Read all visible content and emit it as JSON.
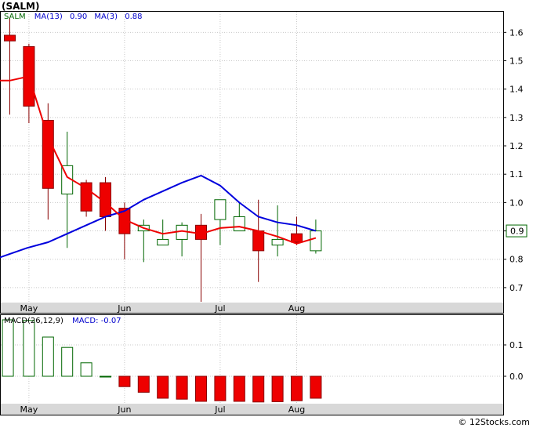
{
  "chart_data": [
    {
      "type": "candlestick",
      "ticker": "(SALM)",
      "legend": {
        "symbol": "SALM",
        "ma13_label": "MA(13)",
        "ma13_value": "0.90",
        "ma3_label": "MA(3)",
        "ma3_value": "0.88"
      },
      "ylim": [
        0.65,
        1.67
      ],
      "y_ticks": [
        "0.7",
        "0.8",
        "0.9",
        "1.0",
        "1.1",
        "1.2",
        "1.3",
        "1.4",
        "1.5",
        "1.6"
      ],
      "x_labels": [
        "May",
        "Jun",
        "Jul",
        "Aug"
      ],
      "x_label_weeks": [
        1,
        6,
        11,
        15
      ],
      "last_price": "0.9",
      "candles": [
        {
          "week": 0,
          "open": 1.59,
          "high": 1.65,
          "low": 1.31,
          "close": 1.57
        },
        {
          "week": 1,
          "open": 1.55,
          "high": 1.56,
          "low": 1.28,
          "close": 1.34
        },
        {
          "week": 2,
          "open": 1.29,
          "high": 1.35,
          "low": 0.94,
          "close": 1.05
        },
        {
          "week": 3,
          "open": 1.03,
          "high": 1.25,
          "low": 0.84,
          "close": 1.13
        },
        {
          "week": 4,
          "open": 1.07,
          "high": 1.08,
          "low": 0.95,
          "close": 0.97
        },
        {
          "week": 5,
          "open": 1.07,
          "high": 1.09,
          "low": 0.9,
          "close": 0.95
        },
        {
          "week": 6,
          "open": 0.98,
          "high": 1.0,
          "low": 0.8,
          "close": 0.89
        },
        {
          "week": 7,
          "open": 0.9,
          "high": 0.94,
          "low": 0.79,
          "close": 0.92
        },
        {
          "week": 8,
          "open": 0.85,
          "high": 0.94,
          "low": 0.85,
          "close": 0.87
        },
        {
          "week": 9,
          "open": 0.87,
          "high": 0.93,
          "low": 0.81,
          "close": 0.92
        },
        {
          "week": 10,
          "open": 0.92,
          "high": 0.96,
          "low": 0.65,
          "close": 0.87
        },
        {
          "week": 11,
          "open": 0.94,
          "high": 1.01,
          "low": 0.85,
          "close": 1.01
        },
        {
          "week": 12,
          "open": 0.9,
          "high": 1.0,
          "low": 0.9,
          "close": 0.95
        },
        {
          "week": 13,
          "open": 0.9,
          "high": 1.01,
          "low": 0.72,
          "close": 0.83
        },
        {
          "week": 14,
          "open": 0.85,
          "high": 0.99,
          "low": 0.81,
          "close": 0.87
        },
        {
          "week": 15,
          "open": 0.89,
          "high": 0.95,
          "low": 0.85,
          "close": 0.86
        },
        {
          "week": 16,
          "open": 0.83,
          "high": 0.94,
          "low": 0.82,
          "close": 0.9
        }
      ],
      "series": [
        {
          "name": "MA(13)",
          "color": "#0000dd",
          "points": [
            {
              "week": -0.8,
              "value": 0.8
            },
            {
              "week": 0.9,
              "value": 0.84
            },
            {
              "week": 2,
              "value": 0.86
            },
            {
              "week": 3,
              "value": 0.89
            },
            {
              "week": 4,
              "value": 0.92
            },
            {
              "week": 5,
              "value": 0.95
            },
            {
              "week": 6,
              "value": 0.97
            },
            {
              "week": 7,
              "value": 1.01
            },
            {
              "week": 8,
              "value": 1.04
            },
            {
              "week": 9,
              "value": 1.07
            },
            {
              "week": 10,
              "value": 1.095
            },
            {
              "week": 11,
              "value": 1.06
            },
            {
              "week": 12,
              "value": 1.0
            },
            {
              "week": 13,
              "value": 0.95
            },
            {
              "week": 14,
              "value": 0.93
            },
            {
              "week": 15,
              "value": 0.92
            },
            {
              "week": 16,
              "value": 0.9
            }
          ]
        },
        {
          "name": "MA(3)",
          "color": "#ee0000",
          "points": [
            {
              "week": -0.8,
              "value": 1.43
            },
            {
              "week": 1,
              "value": 1.445
            },
            {
              "week": 0,
              "value": 1.43
            },
            {
              "week": 2,
              "value": 1.23
            },
            {
              "week": 3,
              "value": 1.09
            },
            {
              "week": 4,
              "value": 1.05
            },
            {
              "week": 5,
              "value": 1.0
            },
            {
              "week": 6,
              "value": 0.94
            },
            {
              "week": 7,
              "value": 0.91
            },
            {
              "week": 8,
              "value": 0.89
            },
            {
              "week": 9,
              "value": 0.9
            },
            {
              "week": 10,
              "value": 0.89
            },
            {
              "week": 11,
              "value": 0.91
            },
            {
              "week": 12,
              "value": 0.915
            },
            {
              "week": 13,
              "value": 0.9
            },
            {
              "week": 14,
              "value": 0.88
            },
            {
              "week": 15,
              "value": 0.855
            },
            {
              "week": 16,
              "value": 0.875
            }
          ]
        }
      ]
    },
    {
      "type": "bar",
      "legend": {
        "label": "MACD(26,12,9)",
        "macd_label": "MACD:",
        "macd_value": "-0.07"
      },
      "ylim": [
        -0.085,
        0.19
      ],
      "y_ticks": [
        "0.1",
        "0.0"
      ],
      "x_labels": [
        "May",
        "Jun",
        "Jul",
        "Aug"
      ],
      "x_label_weeks": [
        1,
        6,
        11,
        15
      ],
      "bars": [
        {
          "week": -0.1,
          "value": 0.18
        },
        {
          "week": 1,
          "value": 0.178
        },
        {
          "week": 2,
          "value": 0.125
        },
        {
          "week": 3,
          "value": 0.092
        },
        {
          "week": 4,
          "value": 0.043
        },
        {
          "week": 5,
          "value": 0.0
        },
        {
          "week": 6,
          "value": -0.033
        },
        {
          "week": 7,
          "value": -0.051
        },
        {
          "week": 8,
          "value": -0.07
        },
        {
          "week": 9,
          "value": -0.073
        },
        {
          "week": 10,
          "value": -0.08
        },
        {
          "week": 11,
          "value": -0.078
        },
        {
          "week": 12,
          "value": -0.08
        },
        {
          "week": 13,
          "value": -0.082
        },
        {
          "week": 14,
          "value": -0.081
        },
        {
          "week": 15,
          "value": -0.078
        },
        {
          "week": 16,
          "value": -0.07
        }
      ]
    }
  ],
  "colors": {
    "up_fill": "#ffffff",
    "up_stroke": "#006600",
    "down_fill": "#ee0000",
    "down_stroke": "#880000",
    "grid": "#c8c8c8",
    "axis_bar": "#d8d8d8",
    "macd_legend_text": "#0000cc",
    "symbol_text": "#006600"
  },
  "footer": {
    "copyright": "© 12Stocks.com"
  }
}
